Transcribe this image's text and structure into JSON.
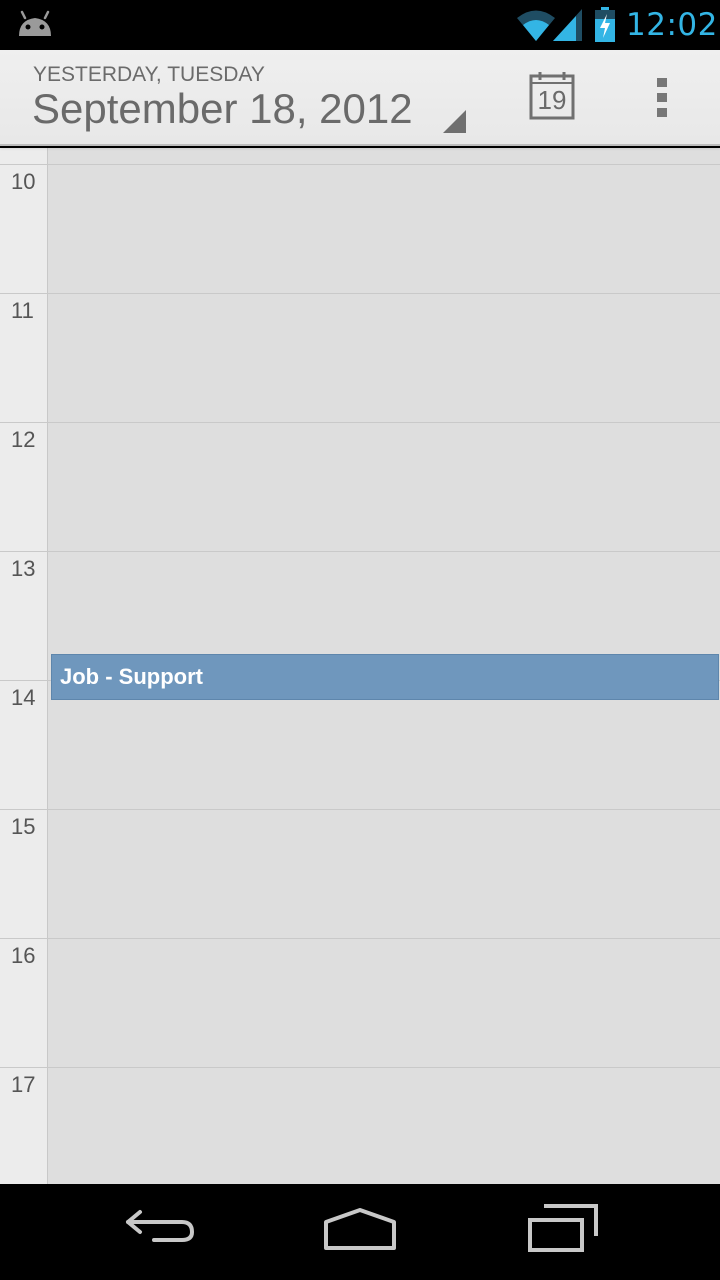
{
  "status_bar": {
    "time": "12:02",
    "time_color": "#33b5e5",
    "icons": [
      "android-icon",
      "wifi-icon",
      "signal-icon",
      "battery-charging-icon"
    ]
  },
  "action_bar": {
    "date_subtitle": "YESTERDAY, TUESDAY",
    "date_title": "September 18, 2012",
    "today_button_day": "19",
    "icons": [
      "dropdown-triangle-icon",
      "today-calendar-icon",
      "overflow-menu-icon"
    ]
  },
  "day_view": {
    "hours": [
      "10",
      "11",
      "12",
      "13",
      "14",
      "15",
      "16",
      "17"
    ],
    "events": [
      {
        "title": "Job - Support",
        "color": "#6f97bd"
      }
    ]
  },
  "nav_bar": {
    "icons": [
      "back-icon",
      "home-icon",
      "recents-icon"
    ]
  }
}
